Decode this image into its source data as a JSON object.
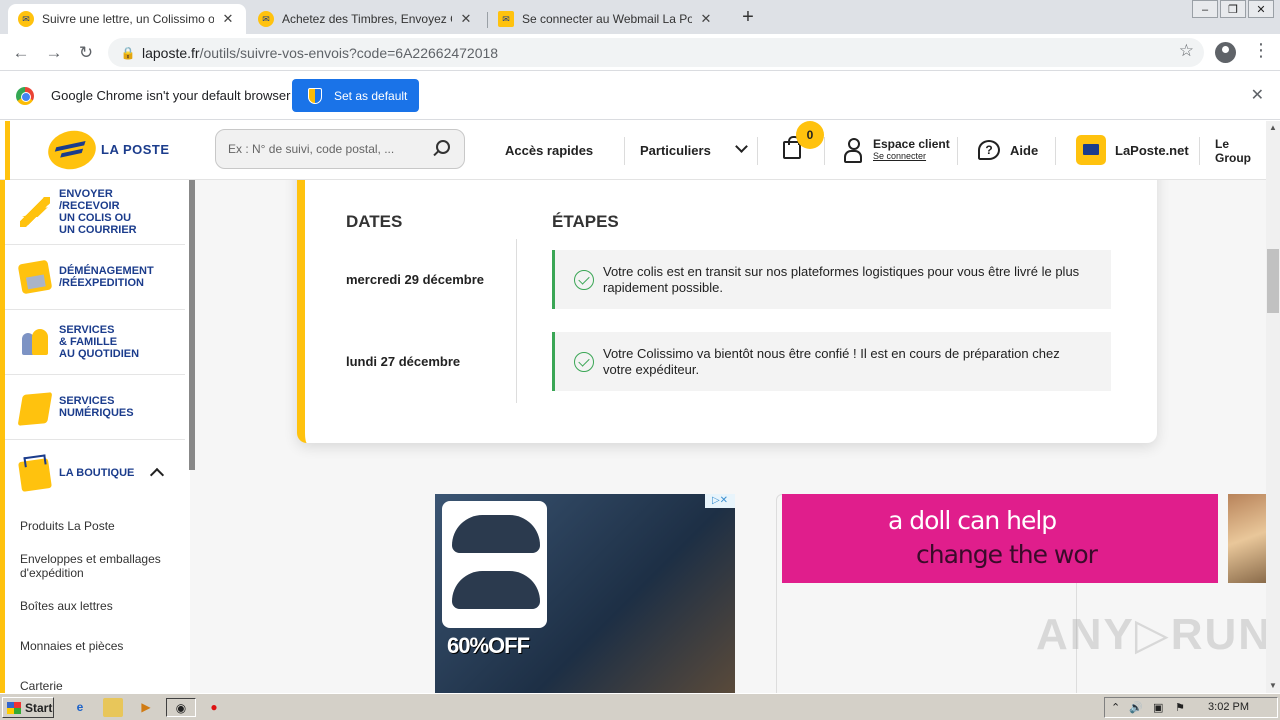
{
  "browser": {
    "tabs": [
      {
        "title": "Suivre une lettre, un Colissimo ou un",
        "active": true,
        "icon": "laposte-favicon"
      },
      {
        "title": "Achetez des Timbres, Envoyez Cour",
        "active": false,
        "icon": "laposte-favicon"
      },
      {
        "title": "Se connecter au Webmail La Poste -",
        "active": false,
        "icon": "mail-favicon"
      }
    ],
    "url_host": "laposte.fr",
    "url_path": "/outils/suivre-vos-envois?code=6A22662472018",
    "infobar_message": "Google Chrome isn't your default browser",
    "infobar_button": "Set as default"
  },
  "header": {
    "logo_text": "LA POSTE",
    "search_placeholder": "Ex : N° de suivi, code postal, ...",
    "acces_rapides": "Accès rapides",
    "particuliers": "Particuliers",
    "cart_count": "0",
    "espace_client": "Espace client",
    "se_connecter": "Se connecter",
    "aide": "Aide",
    "laposte_net": "LaPoste.net",
    "le_groupe": "Le Group"
  },
  "sidebar": {
    "items": [
      {
        "label": "ENVOYER\n/RECEVOIR\nUN COLIS OU\nUN COURRIER",
        "icon": "paper-plane-icon"
      },
      {
        "label": "DÉMÉNAGEMENT\n/RÉEXPEDITION",
        "icon": "moving-box-icon"
      },
      {
        "label": "SERVICES\n& FAMILLE\nAU QUOTIDIEN",
        "icon": "family-icon"
      },
      {
        "label": "SERVICES\nNUMÉRIQUES",
        "icon": "digital-services-icon"
      },
      {
        "label": "LA BOUTIQUE",
        "icon": "shop-basket-icon"
      }
    ],
    "boutique_items": [
      "Produits La Poste",
      "Enveloppes et emballages d'expédition",
      "Boîtes aux lettres",
      "Monnaies et pièces",
      "Carterie"
    ]
  },
  "tracking": {
    "col_dates": "DATES",
    "col_etapes": "ÉTAPES",
    "events": [
      {
        "date": "mercredi 29 décembre",
        "text": "Votre colis est en transit sur nos plateformes logistiques pour vous être livré le plus rapidement possible."
      },
      {
        "date": "lundi 27 décembre",
        "text": "Votre Colissimo va bientôt nous être confié ! Il est en cours de préparation chez votre expéditeur."
      }
    ]
  },
  "ads": {
    "ad1_text": "60%OFF",
    "ad1_badge": "▷✕",
    "ad2_line1": "a doll can help",
    "ad2_line2": "change  the    wor"
  },
  "watermark": "ANY▷RUN",
  "taskbar": {
    "start": "Start",
    "clock": "3:02 PM"
  },
  "colors": {
    "laposte_yellow": "#ffc20e",
    "laposte_blue": "#1b3c8c",
    "step_green": "#3aa655",
    "chrome_blue": "#1a73e8",
    "ad_pink": "#e01e8c"
  }
}
